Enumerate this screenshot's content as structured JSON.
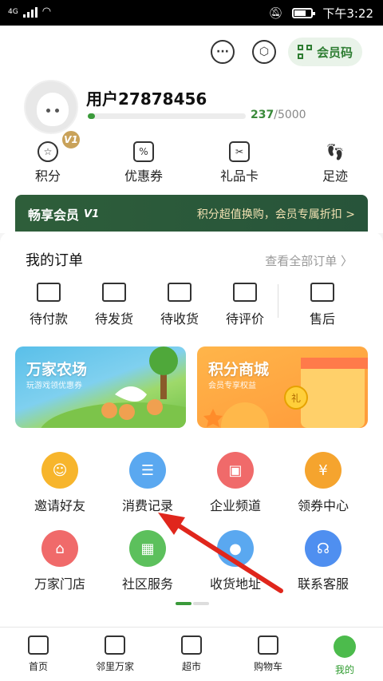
{
  "status": {
    "network": "4G",
    "time": "下午3:22"
  },
  "header": {
    "member_code_label": "会员码",
    "username": "用户27878456",
    "level_badge": "V1",
    "points_current": "237",
    "points_total": "/5000",
    "progress_fraction": 0.0474
  },
  "quick": [
    {
      "label": "积分",
      "icon": "star-circle-icon"
    },
    {
      "label": "优惠券",
      "icon": "coupon-icon"
    },
    {
      "label": "礼品卡",
      "icon": "gift-card-icon"
    },
    {
      "label": "足迹",
      "icon": "footprint-icon"
    }
  ],
  "vipbar": {
    "left": "畅享会员",
    "right": "积分超值换购，会员专属折扣 >"
  },
  "orders": {
    "title": "我的订单",
    "view_all": "查看全部订单",
    "items": [
      {
        "label": "待付款"
      },
      {
        "label": "待发货"
      },
      {
        "label": "待收货"
      },
      {
        "label": "待评价"
      },
      {
        "label": "售后"
      }
    ]
  },
  "banners": [
    {
      "title": "万家农场",
      "subtitle": "玩游戏领优惠券"
    },
    {
      "title": "积分商城",
      "subtitle": "会员专享权益"
    }
  ],
  "services": [
    {
      "label": "邀请好友",
      "color": "#f7b52c"
    },
    {
      "label": "消费记录",
      "color": "#5aa8f0"
    },
    {
      "label": "企业频道",
      "color": "#f06a6a"
    },
    {
      "label": "领券中心",
      "color": "#f5a42e"
    },
    {
      "label": "万家门店",
      "color": "#f06a6a"
    },
    {
      "label": "社区服务",
      "color": "#5cc05c"
    },
    {
      "label": "收货地址",
      "color": "#5aa8f0"
    },
    {
      "label": "联系客服",
      "color": "#4f8ff0"
    }
  ],
  "nav": [
    {
      "label": "首页"
    },
    {
      "label": "邻里万家"
    },
    {
      "label": "超市"
    },
    {
      "label": "购物车"
    },
    {
      "label": "我的"
    }
  ],
  "colors": {
    "brand_green": "#2e7d32",
    "annotation_red": "#e0261c"
  }
}
